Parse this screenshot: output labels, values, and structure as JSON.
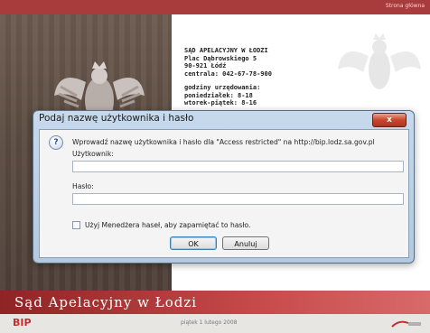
{
  "header": {
    "home_link": "Strona główna"
  },
  "court_info": {
    "lines_address": [
      "SĄD APELACYJNY W ŁODZI",
      "Plac Dąbrowskiego 5",
      "90-921 Łódź",
      "centrala: 042-67-78-900"
    ],
    "lines_hours": [
      "godziny urzędowania:",
      "poniedziałek: 8-18",
      "wtorek-piątek: 8-16"
    ]
  },
  "footer": {
    "court_name": "Sąd Apelacyjny w Łodzi",
    "bip_logo": "BIP",
    "date": "piątek 1 lutego 2008"
  },
  "dialog": {
    "title": "Podaj nazwę użytkownika i hasło",
    "close_label": "x",
    "message": "Wprowadź nazwę użytkownika i hasło dla \"Access restricted\" na http://bip.lodz.sa.gov.pl",
    "username_label": "Użytkownik:",
    "username_value": "",
    "password_label": "Hasło:",
    "password_value": "",
    "remember_label": "Użyj Menedżera haseł, aby zapamiętać to hasło.",
    "remember_checked": false,
    "ok_label": "OK",
    "cancel_label": "Anuluj",
    "icon": "question-icon"
  }
}
